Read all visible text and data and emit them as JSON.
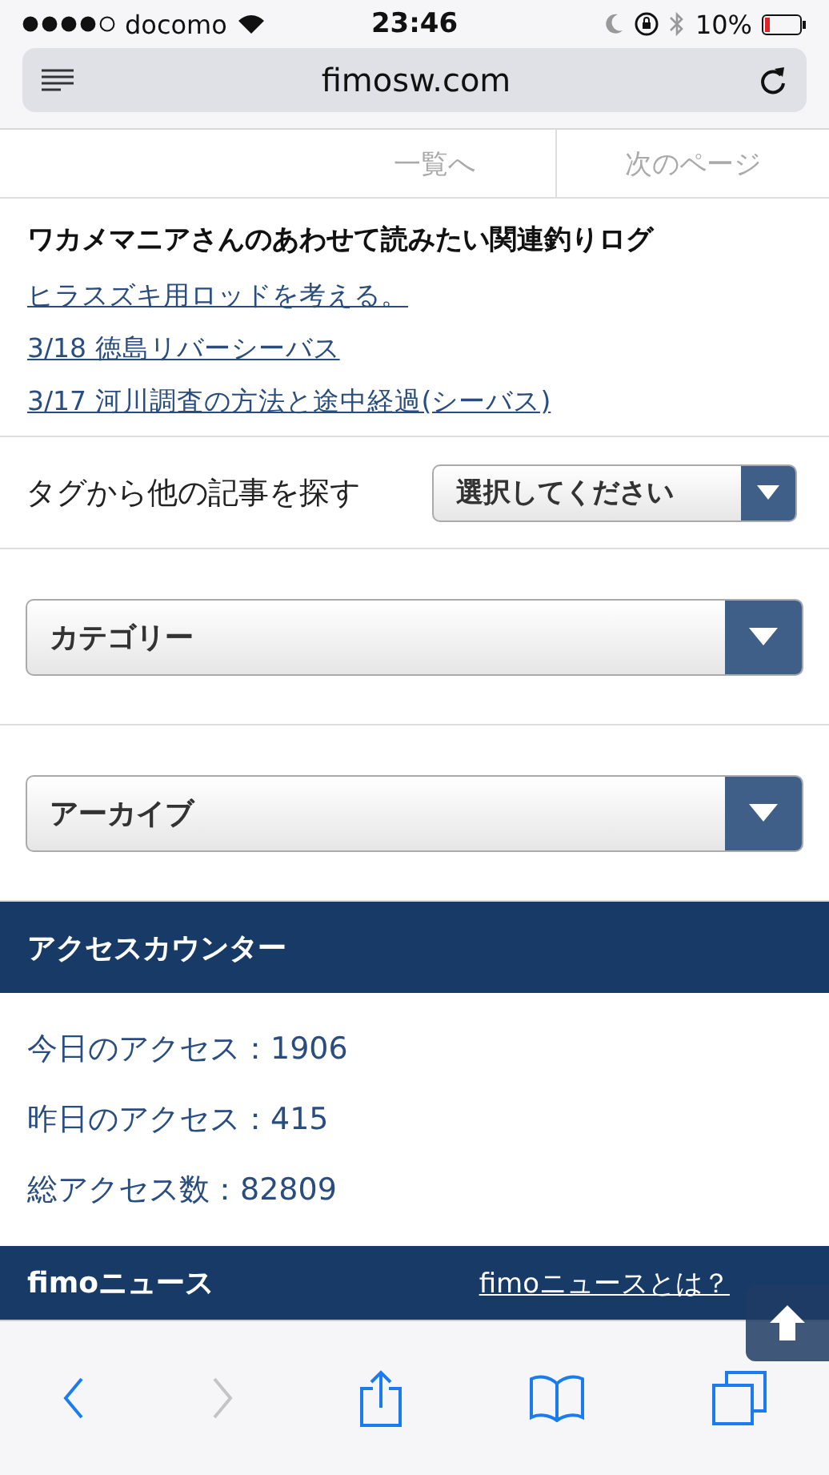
{
  "status_bar": {
    "carrier": "docomo",
    "time": "23:46",
    "battery": "10%"
  },
  "address_bar": {
    "url": "fimosw.com"
  },
  "page_nav": [
    {
      "label": "一覧へ"
    },
    {
      "label": "次のページ"
    }
  ],
  "related": {
    "title": "ワカメマニアさんのあわせて読みたい関連釣りログ",
    "links": [
      "ヒラスズキ用ロッドを考える。",
      "3/18 徳島リバーシーバス",
      "3/17 河川調査の方法と途中経過(シーバス)"
    ]
  },
  "tag_search": {
    "label": "タグから他の記事を探す",
    "select": "選択してください"
  },
  "selects": [
    "カテゴリー",
    "アーカイブ"
  ],
  "access_counter": {
    "title": "アクセスカウンター",
    "lines": [
      "今日のアクセス：1906",
      "昨日のアクセス：415",
      "総アクセス数：82809"
    ]
  },
  "news": {
    "title": "fimoニュース",
    "link": "fimoニュースとは？"
  },
  "toolbar": [
    {
      "kind": "back",
      "disabled": false
    },
    {
      "kind": "forward",
      "disabled": true
    },
    {
      "kind": "share",
      "disabled": false
    },
    {
      "kind": "bookmarks",
      "disabled": false
    },
    {
      "kind": "tabs",
      "disabled": false
    }
  ]
}
